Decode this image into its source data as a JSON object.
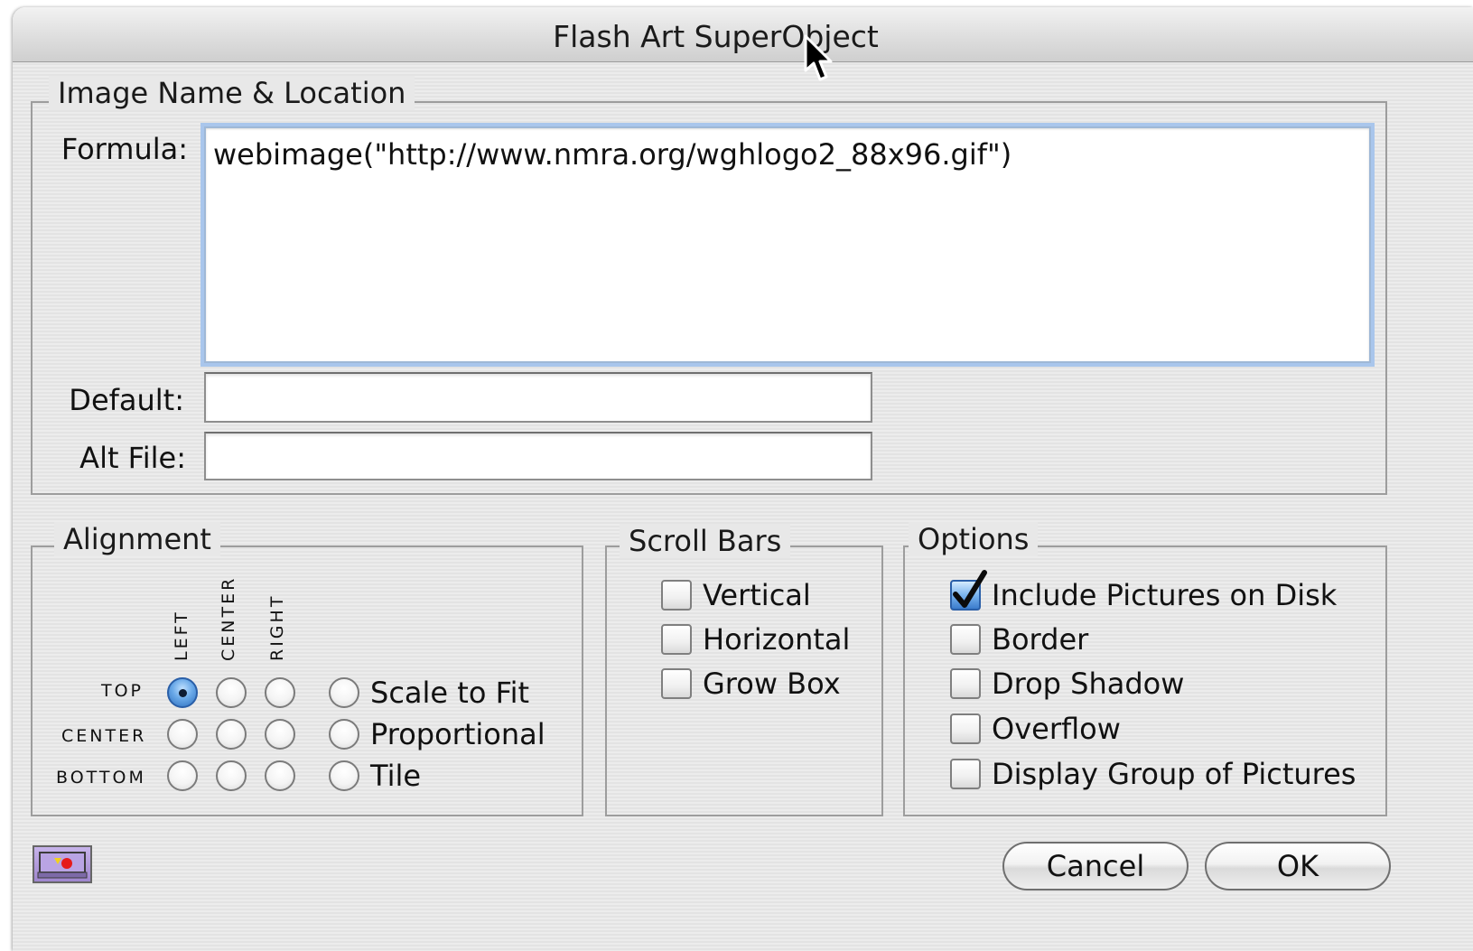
{
  "window": {
    "title": "Flash Art SuperObject"
  },
  "image_group": {
    "title": "Image Name & Location",
    "formula_label": "Formula:",
    "formula_value": "webimage(\"http://www.nmra.org/wghlogo2_88x96.gif\")",
    "default_label": "Default:",
    "default_value": "",
    "altfile_label": "Alt File:",
    "altfile_value": ""
  },
  "alignment": {
    "title": "Alignment",
    "columns": [
      "LEFT",
      "CENTER",
      "RIGHT"
    ],
    "rows": [
      "TOP",
      "CENTER",
      "BOTTOM"
    ],
    "selected": "TOP-LEFT",
    "modes": [
      "Scale to Fit",
      "Proportional",
      "Tile"
    ]
  },
  "scroll_bars": {
    "title": "Scroll Bars",
    "items": [
      {
        "label": "Vertical",
        "checked": false
      },
      {
        "label": "Horizontal",
        "checked": false
      },
      {
        "label": "Grow Box",
        "checked": false
      }
    ]
  },
  "options": {
    "title": "Options",
    "items": [
      {
        "label": "Include Pictures on Disk",
        "checked": true
      },
      {
        "label": "Border",
        "checked": false
      },
      {
        "label": "Drop Shadow",
        "checked": false
      },
      {
        "label": "Overflow",
        "checked": false
      },
      {
        "label": "Display Group of Pictures",
        "checked": false
      }
    ]
  },
  "buttons": {
    "cancel": "Cancel",
    "ok": "OK"
  },
  "icons": {
    "bottom_left": "picture-icon",
    "cursor": "arrow-cursor-icon"
  },
  "colors": {
    "focus_ring": "#a9c6ec",
    "selected_radio": "#2d6fbf",
    "checkbox_checked": "#3b7ccc"
  }
}
